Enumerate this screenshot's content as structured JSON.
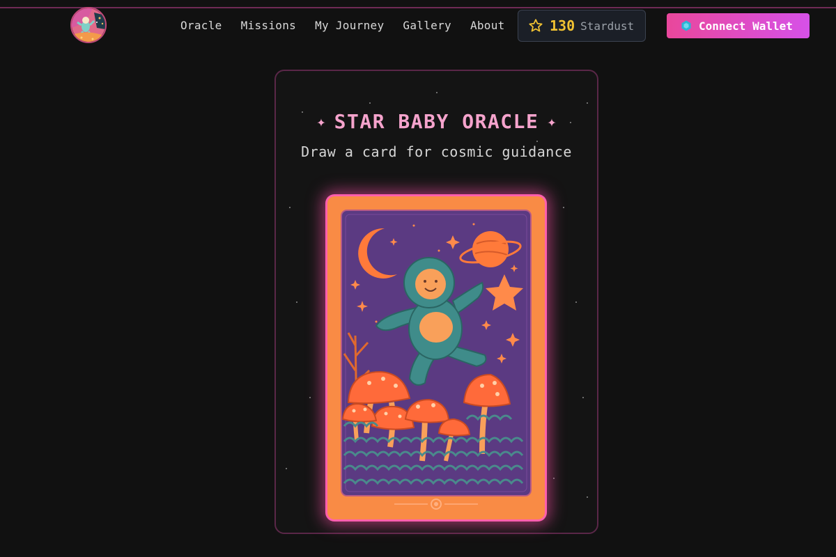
{
  "nav": {
    "items": [
      "Oracle",
      "Missions",
      "My Journey",
      "Gallery",
      "About"
    ]
  },
  "stardust": {
    "count": "130",
    "unit": "Stardust",
    "icon": "star-outline-icon",
    "color": "#f1c232"
  },
  "wallet": {
    "label": "Connect Wallet",
    "icon": "hexagon-icon"
  },
  "oracle": {
    "sparkle": "✦",
    "title": "STAR BABY ORACLE",
    "subtitle": "Draw a card for cosmic guidance"
  },
  "card": {
    "art": "star-baby-tarot-card",
    "colors": {
      "frame": "#f98b45",
      "glow": "#ff5fae",
      "sky": "#5b3a82",
      "baby": "#3f8c8a"
    }
  }
}
